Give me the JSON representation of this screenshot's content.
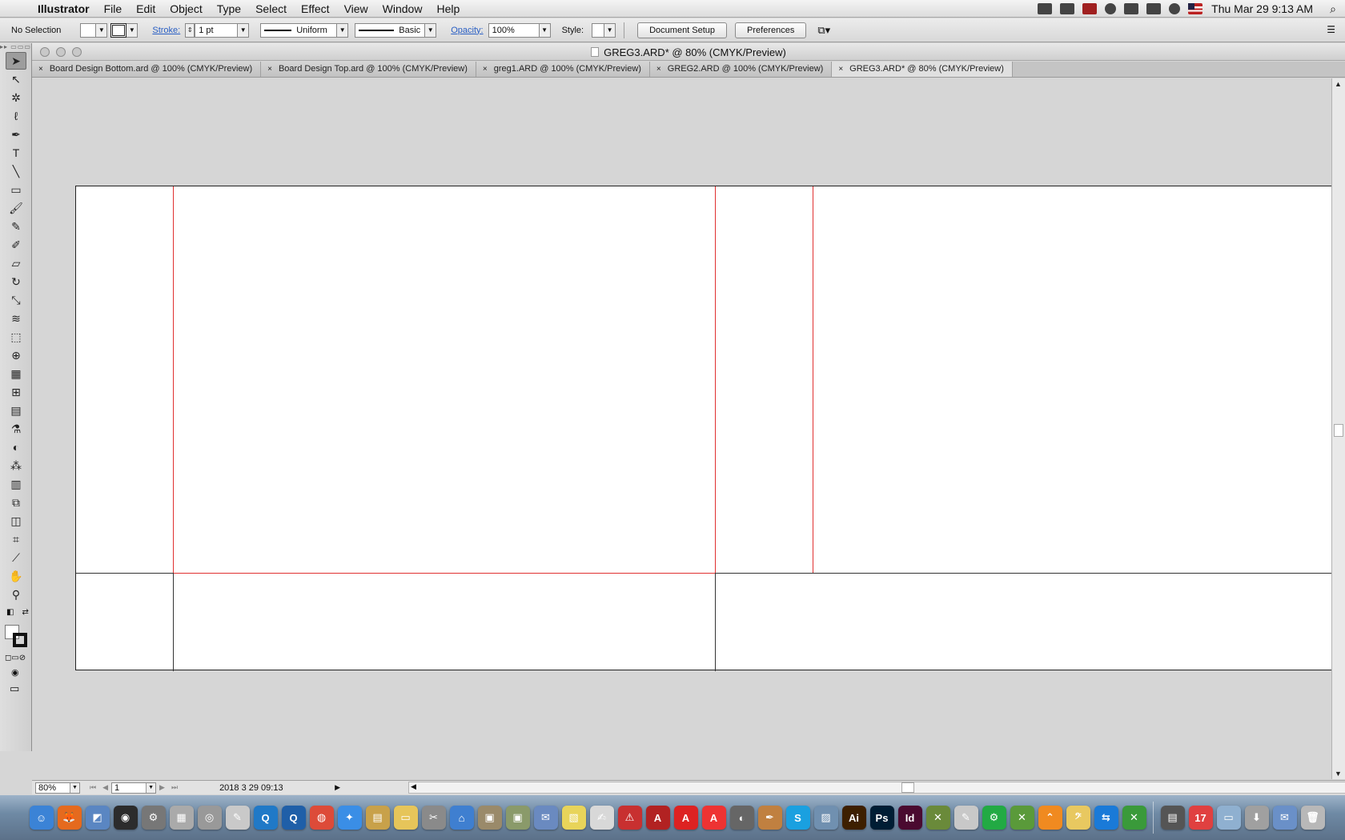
{
  "menubar": {
    "apple": "",
    "app_name": "Illustrator",
    "menus": [
      "File",
      "Edit",
      "Object",
      "Type",
      "Select",
      "Effect",
      "View",
      "Window",
      "Help"
    ],
    "status_icons": [
      "creative-cloud-icon",
      "acrobat-icon",
      "shield-icon",
      "paw-icon",
      "display-icon",
      "battery-icon",
      "sync-icon",
      "flag-icon"
    ],
    "clock": "Thu Mar 29  9:13 AM",
    "spotlight": "⌕"
  },
  "controlbar": {
    "selection_label": "No Selection",
    "stroke_label": "Stroke:",
    "stroke_weight": "1 pt",
    "stroke_profile": "Uniform",
    "brush": "Basic",
    "opacity_label": "Opacity:",
    "opacity_value": "100%",
    "style_label": "Style:",
    "document_setup": "Document Setup",
    "preferences": "Preferences",
    "panel_menu": "☰"
  },
  "document": {
    "title": "GREG3.ARD* @ 80% (CMYK/Preview)",
    "tabs": [
      {
        "label": "Board Design Bottom.ard @ 100% (CMYK/Preview)",
        "active": false
      },
      {
        "label": "Board Design Top.ard @ 100% (CMYK/Preview)",
        "active": false
      },
      {
        "label": "greg1.ARD @ 100% (CMYK/Preview)",
        "active": false
      },
      {
        "label": "GREG2.ARD @ 100% (CMYK/Preview)",
        "active": false
      },
      {
        "label": "GREG3.ARD* @ 80% (CMYK/Preview)",
        "active": true
      }
    ],
    "tab_close": "×"
  },
  "tools": [
    {
      "name": "selection-tool",
      "glyph": "➤"
    },
    {
      "name": "direct-selection-tool",
      "glyph": "↖"
    },
    {
      "name": "magic-wand-tool",
      "glyph": "✲"
    },
    {
      "name": "lasso-tool",
      "glyph": "ℓ"
    },
    {
      "name": "pen-tool",
      "glyph": "✒"
    },
    {
      "name": "type-tool",
      "glyph": "T"
    },
    {
      "name": "line-tool",
      "glyph": "╲"
    },
    {
      "name": "rectangle-tool",
      "glyph": "▭"
    },
    {
      "name": "paintbrush-tool",
      "glyph": "🖌"
    },
    {
      "name": "pencil-tool",
      "glyph": "✎"
    },
    {
      "name": "blob-brush-tool",
      "glyph": "✐"
    },
    {
      "name": "eraser-tool",
      "glyph": "▱"
    },
    {
      "name": "rotate-tool",
      "glyph": "↻"
    },
    {
      "name": "scale-tool",
      "glyph": "⤡"
    },
    {
      "name": "warp-tool",
      "glyph": "≋"
    },
    {
      "name": "free-transform-tool",
      "glyph": "⬚"
    },
    {
      "name": "shape-builder-tool",
      "glyph": "⊕"
    },
    {
      "name": "perspective-grid-tool",
      "glyph": "▦"
    },
    {
      "name": "mesh-tool",
      "glyph": "⊞"
    },
    {
      "name": "gradient-tool",
      "glyph": "▤"
    },
    {
      "name": "eyedropper-tool",
      "glyph": "⚗"
    },
    {
      "name": "blend-tool",
      "glyph": "◐"
    },
    {
      "name": "symbol-sprayer-tool",
      "glyph": "⁂"
    },
    {
      "name": "column-graph-tool",
      "glyph": "▥"
    },
    {
      "name": "artboard-tool",
      "glyph": "⧉"
    },
    {
      "name": "slice-tool",
      "glyph": "◫"
    },
    {
      "name": "crop-tool",
      "glyph": "⌗"
    },
    {
      "name": "knife-tool",
      "glyph": "⟋"
    },
    {
      "name": "hand-tool",
      "glyph": "✋"
    },
    {
      "name": "zoom-tool",
      "glyph": "⚲"
    }
  ],
  "tool_extras": {
    "default_colors": "◧",
    "swap_colors": "⇄",
    "color_modes": "◻▭⊘",
    "draw_mode": "◉",
    "screen_mode": "▭"
  },
  "statusbar": {
    "zoom": "80%",
    "artboard_number": "1",
    "datetime": "2018 3 29  09:13",
    "nav_first": "⏮",
    "nav_prev": "◀",
    "nav_next": "▶",
    "nav_last": "⏭",
    "info_arrow": "▶",
    "scroll_left": "◀",
    "scroll_right": "▶"
  },
  "vscroll": {
    "up": "▲",
    "down": "▼"
  },
  "dock": [
    {
      "name": "finder-icon",
      "label": "☺",
      "color": "#3b83d6"
    },
    {
      "name": "firefox-icon",
      "label": "🦊",
      "color": "#e56a1e"
    },
    {
      "name": "preview-icon",
      "label": "◩",
      "color": "#5a86c2"
    },
    {
      "name": "activity-monitor-icon",
      "label": "◉",
      "color": "#2c2c2c"
    },
    {
      "name": "system-info-icon",
      "label": "⚙",
      "color": "#777777"
    },
    {
      "name": "calculator-icon",
      "label": "▦",
      "color": "#aaaaaa"
    },
    {
      "name": "dvd-player-icon",
      "label": "◎",
      "color": "#999999"
    },
    {
      "name": "script-editor-icon",
      "label": "✎",
      "color": "#c9c9c9"
    },
    {
      "name": "quicktime-icon",
      "label": "Q",
      "color": "#2079c7"
    },
    {
      "name": "quicktime-7-icon",
      "label": "Q",
      "color": "#1f5fa8"
    },
    {
      "name": "chrome-icon",
      "label": "◍",
      "color": "#dd4b39"
    },
    {
      "name": "safari-icon",
      "label": "✦",
      "color": "#3a8ee6"
    },
    {
      "name": "notes-icon",
      "label": "▤",
      "color": "#c8a14a"
    },
    {
      "name": "folder-icon",
      "label": "▭",
      "color": "#e6c55a"
    },
    {
      "name": "scissors-icon",
      "label": "✂",
      "color": "#8a8a8a"
    },
    {
      "name": "home-icon",
      "label": "⌂",
      "color": "#3f7fd0"
    },
    {
      "name": "installer-icon",
      "label": "▣",
      "color": "#9a8a6a"
    },
    {
      "name": "package-icon",
      "label": "▣",
      "color": "#8a9a6a"
    },
    {
      "name": "mail-stamp-icon",
      "label": "✉",
      "color": "#6a8ac0"
    },
    {
      "name": "stickies-icon",
      "label": "▧",
      "color": "#e8d45a"
    },
    {
      "name": "textedit-icon",
      "label": "✍",
      "color": "#d8d8d8"
    },
    {
      "name": "pdf-icon",
      "label": "⚠",
      "color": "#c83030"
    },
    {
      "name": "acrobat-pro-icon",
      "label": "A",
      "color": "#b22222"
    },
    {
      "name": "acrobat-reader-icon",
      "label": "A",
      "color": "#d22"
    },
    {
      "name": "acrobat-distiller-icon",
      "label": "A",
      "color": "#e33"
    },
    {
      "name": "spotify-icon",
      "label": "◐",
      "color": "#666666"
    },
    {
      "name": "pen-nib-icon",
      "label": "✒",
      "color": "#c08040"
    },
    {
      "name": "skype-icon",
      "label": "S",
      "color": "#1aa0e0"
    },
    {
      "name": "image-capture-icon",
      "label": "▨",
      "color": "#7090b0"
    },
    {
      "name": "illustrator-icon",
      "label": "Ai",
      "color": "#3d1f00"
    },
    {
      "name": "photoshop-icon",
      "label": "Ps",
      "color": "#001d34"
    },
    {
      "name": "indesign-icon",
      "label": "Id",
      "color": "#4a0a30"
    },
    {
      "name": "x11-icon",
      "label": "✕",
      "color": "#6a8a3a"
    },
    {
      "name": "drawing-icon",
      "label": "✎",
      "color": "#c8c8c8"
    },
    {
      "name": "system-preferences-icon",
      "label": "⚙",
      "color": "#22aa44"
    },
    {
      "name": "x-app-icon",
      "label": "✕",
      "color": "#5a9a3a"
    },
    {
      "name": "transmit-icon",
      "label": "⌃",
      "color": "#f08a20"
    },
    {
      "name": "bass-clef-icon",
      "label": "𝄢",
      "color": "#e8c860"
    },
    {
      "name": "teamviewer-icon",
      "label": "⇆",
      "color": "#1a7ad8"
    },
    {
      "name": "xquartz-icon",
      "label": "✕",
      "color": "#3a9a3a"
    },
    {
      "name": "printer-icon",
      "label": "▤",
      "color": "#555555"
    },
    {
      "name": "calendar-icon",
      "label": "17",
      "color": "#e04040"
    },
    {
      "name": "documents-folder-icon",
      "label": "▭",
      "color": "#8fb0d0"
    },
    {
      "name": "downloads-stack-icon",
      "label": "⬇",
      "color": "#a0a0a0"
    },
    {
      "name": "mail-icon",
      "label": "✉",
      "color": "#6a90c8"
    },
    {
      "name": "trash-icon",
      "label": "🗑",
      "color": "#b8b8b8"
    }
  ]
}
